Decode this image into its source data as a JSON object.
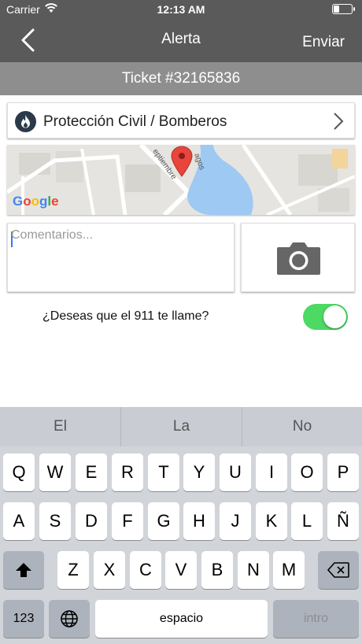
{
  "status_bar": {
    "carrier": "Carrier",
    "time": "12:13 AM",
    "battery_level": 0.3
  },
  "nav": {
    "back_icon": "chevron-left-icon",
    "title": "Alerta",
    "send_label": "Enviar"
  },
  "ticket": {
    "label": "Ticket #32165836"
  },
  "category": {
    "icon": "fire-icon",
    "label": "Protección Civil / Bomberos",
    "chevron_icon": "chevron-right-icon"
  },
  "map": {
    "logo": "Google"
  },
  "comments": {
    "placeholder": "Comentarios..."
  },
  "camera": {
    "icon": "camera-icon"
  },
  "call_option": {
    "label": "¿Deseas que el 911 te llame?",
    "enabled": true
  },
  "keyboard": {
    "suggestions": [
      "El",
      "La",
      "No"
    ],
    "row1": [
      "Q",
      "W",
      "E",
      "R",
      "T",
      "Y",
      "U",
      "I",
      "O",
      "P"
    ],
    "row2": [
      "A",
      "S",
      "D",
      "F",
      "G",
      "H",
      "J",
      "K",
      "L",
      "Ñ"
    ],
    "row3": [
      "Z",
      "X",
      "C",
      "V",
      "B",
      "N",
      "M"
    ],
    "numbers_label": "123",
    "space_label": "espacio",
    "return_label": "intro",
    "shift_icon": "shift-icon",
    "delete_icon": "delete-icon",
    "globe_icon": "globe-icon"
  },
  "colors": {
    "header": "#5a5a5a",
    "ticket_bar": "#8e8e8e",
    "toggle_on": "#4cd964",
    "map_pin": "#e8453c",
    "water": "#9ec9f2"
  }
}
